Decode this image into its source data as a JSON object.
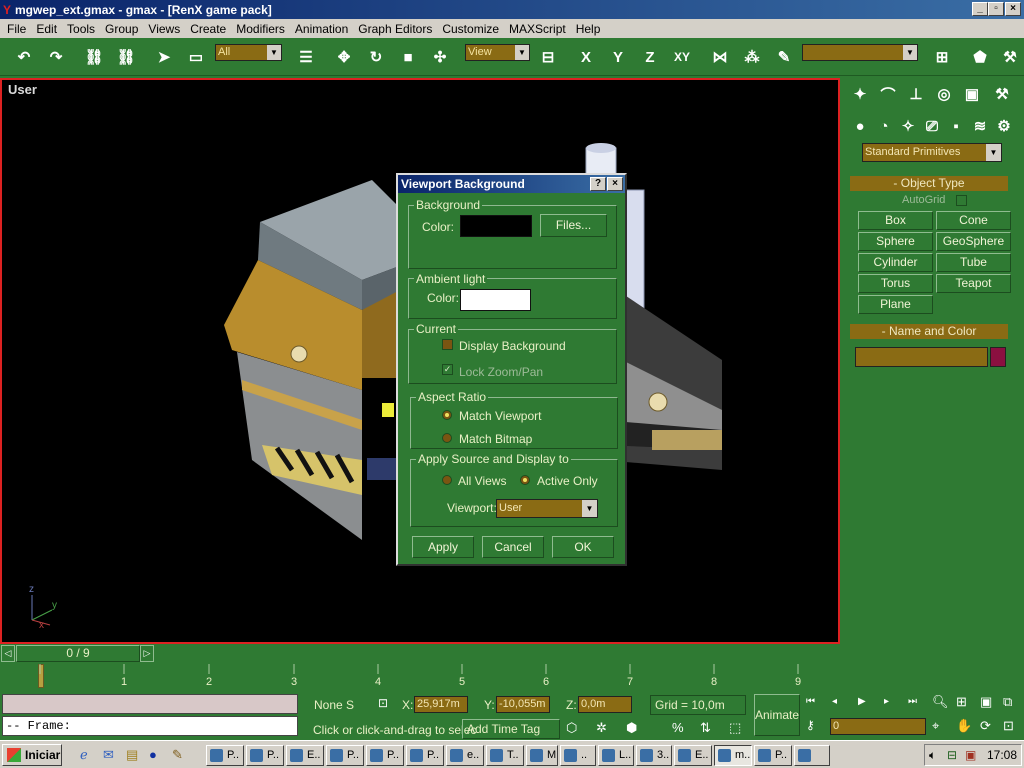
{
  "window": {
    "title": "mgwep_ext.gmax - gmax - [RenX game pack]"
  },
  "menu": [
    "File",
    "Edit",
    "Tools",
    "Group",
    "Views",
    "Create",
    "Modifiers",
    "Animation",
    "Graph Editors",
    "Customize",
    "MAXScript",
    "Help"
  ],
  "toolbar": {
    "selection_filter": "All",
    "reference_coord": "View",
    "axis_x": "X",
    "axis_y": "Y",
    "axis_z": "Z",
    "axis_xy": "XY"
  },
  "viewport": {
    "label": "User"
  },
  "dialog": {
    "title": "Viewport Background",
    "background_group": "Background",
    "color_label": "Color:",
    "background_color": "#000000",
    "files_button": "Files...",
    "ambient_group": "Ambient light",
    "ambient_color_label": "Color:",
    "ambient_color": "#ffffff",
    "current_group": "Current",
    "display_background": "Display Background",
    "lock_zoom_pan": "Lock Zoom/Pan",
    "aspect_group": "Aspect Ratio",
    "match_viewport": "Match Viewport",
    "match_bitmap": "Match Bitmap",
    "apply_group": "Apply Source and Display to",
    "all_views": "All Views",
    "active_only": "Active Only",
    "viewport_label": "Viewport:",
    "viewport_value": "User",
    "apply_button": "Apply",
    "cancel_button": "Cancel",
    "ok_button": "OK"
  },
  "command_panel": {
    "category": "Standard Primitives",
    "object_type_title": "Object Type",
    "autogrid": "AutoGrid",
    "buttons": [
      "Box",
      "Cone",
      "Sphere",
      "GeoSphere",
      "Cylinder",
      "Tube",
      "Torus",
      "Teapot",
      "Plane"
    ],
    "name_color_title": "Name and Color",
    "object_color": "#8b1040"
  },
  "timeline": {
    "frame_counter": "0 / 9",
    "ticks": [
      "1",
      "2",
      "3",
      "4",
      "5",
      "6",
      "7",
      "8",
      "9"
    ]
  },
  "status": {
    "frame_label": "-- Frame:",
    "selection": "None S",
    "x_label": "X:",
    "x_value": "25,917m",
    "y_label": "Y:",
    "y_value": "-10,055m",
    "z_label": "Z:",
    "z_value": "0,0m",
    "grid": "Grid = 10,0m",
    "prompt": "Click or click-and-drag to selec",
    "time_tag": "Add Time Tag",
    "animate": "Animate",
    "current_frame": "0"
  },
  "taskbar": {
    "start": "Iniciar",
    "tasks": [
      "P..",
      "P..",
      "E..",
      "P..",
      "P..",
      "P..",
      "e..",
      "T..",
      "M..",
      "..",
      "L..",
      "3..",
      "E..",
      "m..",
      "P..",
      ""
    ],
    "clock": "17:08"
  }
}
